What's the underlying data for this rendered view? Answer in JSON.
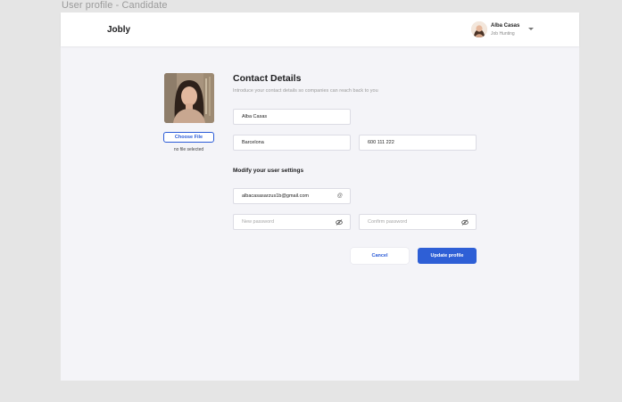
{
  "frame_title": "User profile - Candidate",
  "header": {
    "logo": "Jobly",
    "user": {
      "name": "Alba Casas",
      "status": "Job Hunting"
    }
  },
  "profile_photo": {
    "choose_label": "Choose File",
    "file_status": "no file selected"
  },
  "contact": {
    "title": "Contact Details",
    "subtitle": "Introduce your contact details so companies can reach back to you",
    "name_value": "Alba Casas",
    "city_value": "Barcelona",
    "phone_value": "600 111 222"
  },
  "settings": {
    "title": "Modify your user settings",
    "email_value": "albacasasarzus1b@gmail.com",
    "new_password_placeholder": "New password",
    "confirm_password_placeholder": "Confirm password"
  },
  "actions": {
    "cancel_label": "Cancel",
    "update_label": "Update profile"
  },
  "colors": {
    "accent": "#2e5fd6",
    "background": "#f4f4f8",
    "canvas": "#e5e5e5"
  },
  "icons": [
    "at-sign-icon",
    "eye-off-icon",
    "chevron-down-icon",
    "avatar"
  ]
}
